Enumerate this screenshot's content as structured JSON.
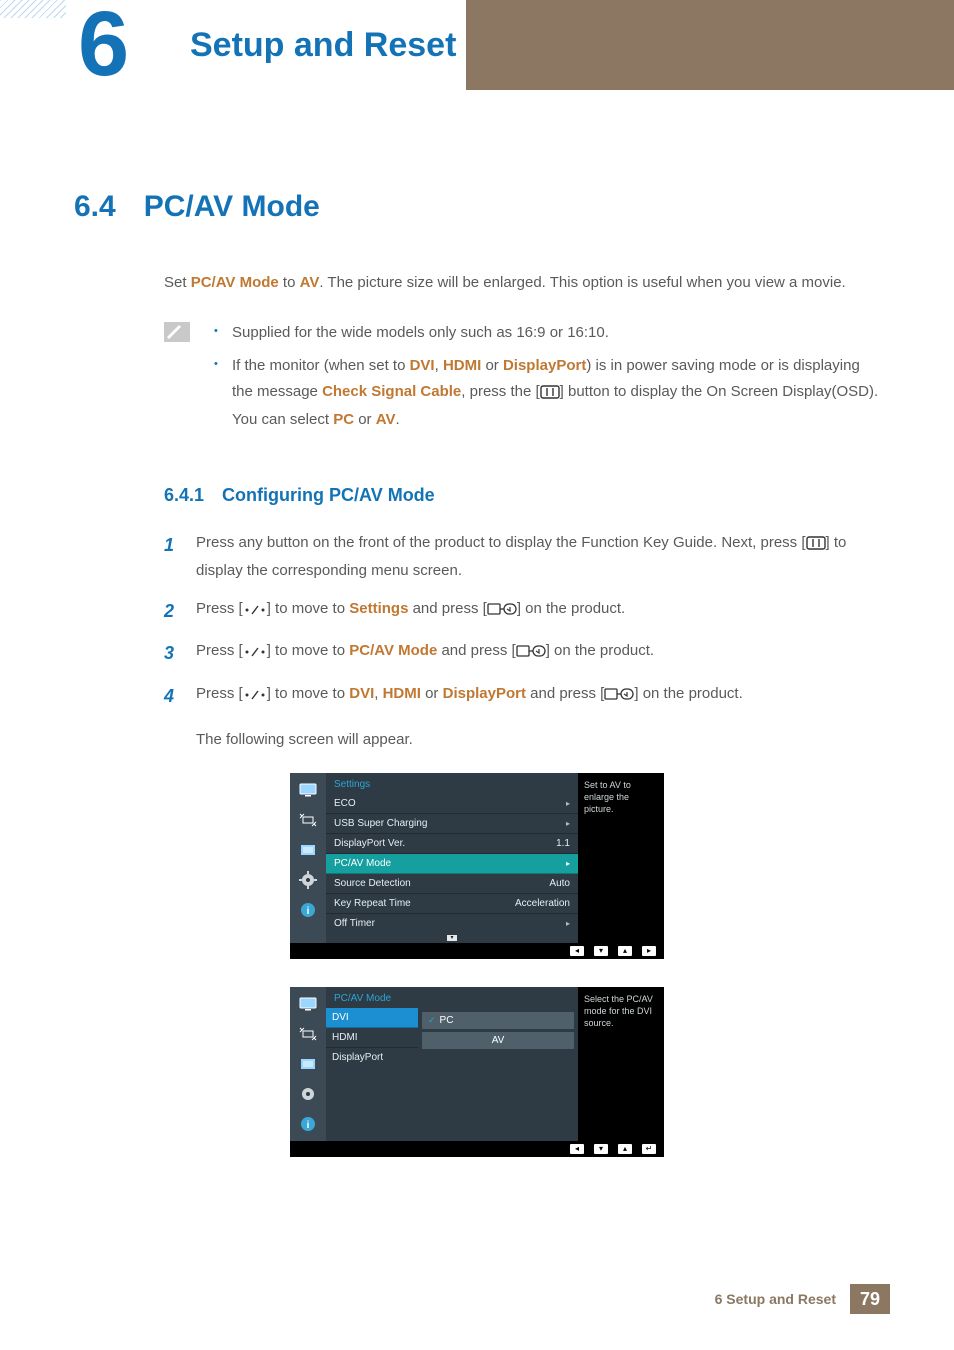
{
  "chapter": {
    "number": "6",
    "title": "Setup and Reset"
  },
  "section": {
    "number": "6.4",
    "title": "PC/AV Mode"
  },
  "intro": {
    "pre": "Set ",
    "accent1": "PC/AV Mode",
    "mid": " to ",
    "accent2": "AV",
    "post": ". The picture size will be enlarged. This option is useful when you view a movie."
  },
  "notes": {
    "b1": "Supplied for the wide models only such as 16:9 or 16:10.",
    "b2_pre": "If the monitor (when set to ",
    "b2_dvi": "DVI",
    "b2_sep1": ", ",
    "b2_hdmi": "HDMI",
    "b2_sep2": " or ",
    "b2_dp": "DisplayPort",
    "b2_mid": ") is in power saving mode or is displaying the message ",
    "b2_check": "Check Signal Cable",
    "b2_post1": ", press the [",
    "b2_post2": "] button to display the On Screen Display(OSD). You can select ",
    "b2_pc": "PC",
    "b2_or": " or ",
    "b2_av": "AV",
    "b2_end": "."
  },
  "subsection": {
    "number": "6.4.1",
    "title": "Configuring PC/AV Mode"
  },
  "steps": {
    "s1a": "Press any button on the front of the product to display the Function Key Guide. Next, press [",
    "s1b": "] to display the corresponding menu screen.",
    "s2a": "Press [",
    "s2_mid": "] to move to ",
    "s2_settings": "Settings",
    "s2b": " and press [",
    "s2c": "] on the product.",
    "s3_pcav": "PC/AV Mode",
    "s4_dvi": "DVI",
    "s4_sep1": ", ",
    "s4_hdmi": "HDMI",
    "s4_sep2": " or ",
    "s4_dp": "DisplayPort",
    "following": "The following screen will appear."
  },
  "step_numbers": {
    "n1": "1",
    "n2": "2",
    "n3": "3",
    "n4": "4"
  },
  "osd1": {
    "title": "Settings",
    "rows": [
      {
        "label": "ECO",
        "value": ""
      },
      {
        "label": "USB Super Charging",
        "value": ""
      },
      {
        "label": "DisplayPort Ver.",
        "value": "1.1"
      },
      {
        "label": "PC/AV Mode",
        "value": ""
      },
      {
        "label": "Source Detection",
        "value": "Auto"
      },
      {
        "label": "Key Repeat Time",
        "value": "Acceleration"
      },
      {
        "label": "Off Timer",
        "value": ""
      }
    ],
    "help": "Set to AV to enlarge the picture."
  },
  "osd2": {
    "title": "PC/AV Mode",
    "sources": [
      "DVI",
      "HDMI",
      "DisplayPort"
    ],
    "options": [
      "PC",
      "AV"
    ],
    "help": "Select the PC/AV mode for the DVI source."
  },
  "footer": {
    "chapter": "6 Setup and Reset",
    "page": "79"
  }
}
